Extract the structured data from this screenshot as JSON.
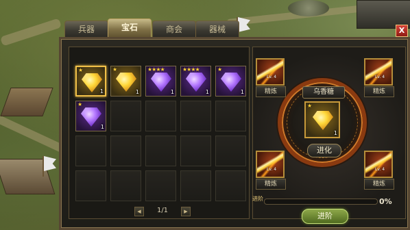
{
  "tabs": [
    {
      "label": "兵器"
    },
    {
      "label": "宝石"
    },
    {
      "label": "商会"
    },
    {
      "label": "器械"
    }
  ],
  "active_tab": "宝石",
  "close_label": "X",
  "inventory": {
    "slots": [
      {
        "gem": "gold",
        "stars": 1,
        "count": "1",
        "selected": true
      },
      {
        "gem": "gold",
        "stars": 1,
        "count": "1"
      },
      {
        "gem": "purple",
        "stars": 4,
        "count": "1"
      },
      {
        "gem": "purple",
        "stars": 4,
        "count": "1"
      },
      {
        "gem": "purple",
        "stars": 1,
        "count": "1"
      },
      {
        "gem": "purple",
        "stars": 1,
        "count": "1"
      },
      {},
      {},
      {},
      {},
      {},
      {},
      {},
      {},
      {},
      {},
      {},
      {},
      {},
      {}
    ],
    "pager": {
      "prev": "◀",
      "text": "1/1",
      "next": "▶"
    }
  },
  "forge": {
    "item_name": "乌香糖",
    "center_slot": {
      "gem": "gold",
      "stars": 1,
      "count": "1"
    },
    "evolve_label": "进化",
    "skills": [
      {
        "level": "Lv. 4",
        "action": "精炼"
      },
      {
        "level": "Lv. 4",
        "action": "精炼"
      },
      {
        "level": "Lv. 4",
        "action": "精炼"
      },
      {
        "level": "Lv. 4",
        "action": "精炼"
      }
    ],
    "progress_label": "进阶",
    "progress_value": 0,
    "progress_text": "0%",
    "advance_label": "进阶"
  },
  "icons": {
    "gold_gem": "gold-gem-icon",
    "purple_gem": "purple-gem-icon",
    "skill": "fire-slash-skill-icon",
    "star": "★"
  },
  "colors": {
    "gold_gem": "#ffd83a",
    "purple_gem": "#9a5cf0",
    "selection": "#f0c048",
    "advance_button": "#7a9a3a",
    "ring": "#8a3a10"
  }
}
